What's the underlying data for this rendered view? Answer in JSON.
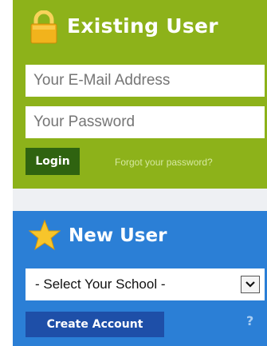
{
  "existing_user": {
    "title": "Existing User",
    "icon": "lock-icon",
    "email_placeholder": "Your E-Mail Address",
    "password_placeholder": "Your Password",
    "login_label": "Login",
    "forgot_label": "Forgot your password?"
  },
  "new_user": {
    "title": "New User",
    "icon": "star-icon",
    "school_select_value": "- Select Your School -",
    "create_account_label": "Create Account",
    "help_label": "?"
  },
  "colors": {
    "existing_panel": "#8db21a",
    "login_button": "#2f6310",
    "new_panel": "#2b7fd6",
    "create_button": "#1e4fa8"
  }
}
